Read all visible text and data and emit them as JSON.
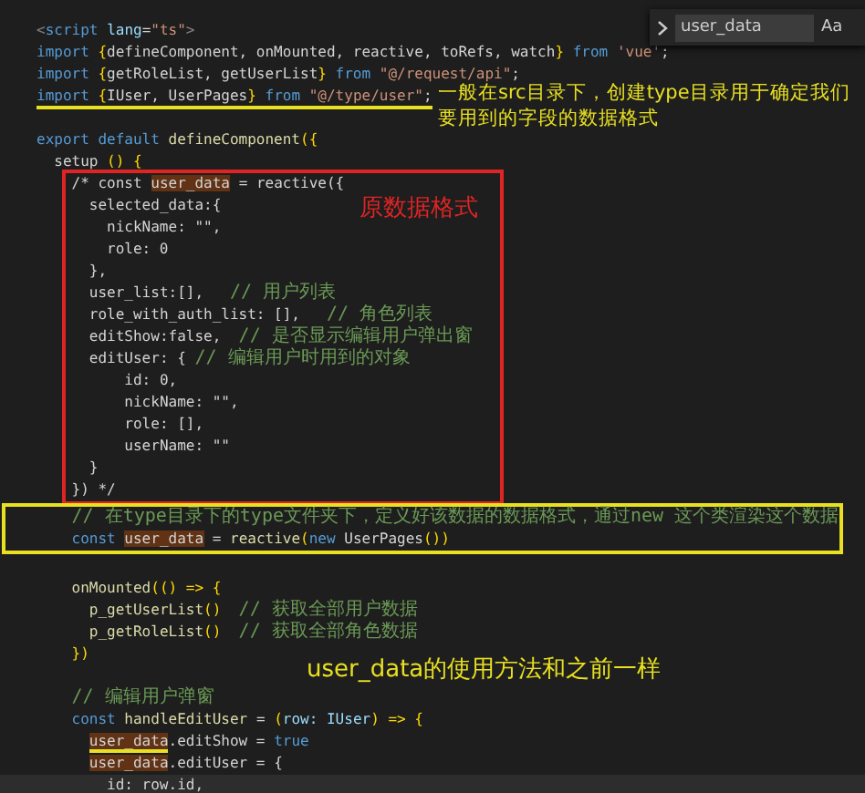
{
  "editor": {
    "blocks": [
      {
        "kind": "plain",
        "lines": [
          {
            "tokens": [
              {
                "t": "<",
                "kind": "tag"
              },
              {
                "t": "script",
                "kind": "kw"
              },
              {
                "t": " lang",
                "kind": "var"
              },
              {
                "t": "=",
                "kind": "p"
              },
              {
                "t": "\"ts\"",
                "kind": "str"
              },
              {
                "t": ">",
                "kind": "tag"
              }
            ]
          },
          {
            "tokens": [
              {
                "t": "import ",
                "kind": "kw"
              },
              {
                "t": "{",
                "kind": "br"
              },
              {
                "t": "defineComponent, onMounted, reactive, toRefs, watch",
                "kind": "p"
              },
              {
                "t": "}",
                "kind": "br"
              },
              {
                "t": " from ",
                "kind": "kw"
              },
              {
                "t": "'vue'",
                "kind": "str"
              },
              {
                "t": ";",
                "kind": "p"
              }
            ]
          },
          {
            "tokens": [
              {
                "t": "import ",
                "kind": "kw"
              },
              {
                "t": "{",
                "kind": "br"
              },
              {
                "t": "getRoleList, getUserList",
                "kind": "p"
              },
              {
                "t": "}",
                "kind": "br"
              },
              {
                "t": " from ",
                "kind": "kw"
              },
              {
                "t": "\"@/request/api\"",
                "kind": "str"
              },
              {
                "t": ";",
                "kind": "p"
              }
            ]
          },
          {
            "underlined": true,
            "note": "一般在src目录下，创建type目录用于确定我们要用到的字段的数据格式",
            "tokens": [
              {
                "t": "import ",
                "kind": "kw"
              },
              {
                "t": "{",
                "kind": "br"
              },
              {
                "t": "IUser, UserPages",
                "kind": "p"
              },
              {
                "t": "}",
                "kind": "br"
              },
              {
                "t": " from ",
                "kind": "kw"
              },
              {
                "t": "\"@/type/user\"",
                "kind": "str"
              },
              {
                "t": ";",
                "kind": "p"
              }
            ]
          },
          {
            "space_above": true,
            "tokens": [
              {
                "t": "export default ",
                "kind": "kw"
              },
              {
                "t": "defineComponent",
                "kind": "fn"
              },
              {
                "t": "({",
                "kind": "br"
              }
            ]
          },
          {
            "tokens": [
              {
                "t": "  setup ",
                "kind": "p"
              },
              {
                "t": "() {",
                "kind": "br"
              }
            ]
          }
        ]
      },
      {
        "kind": "red-frame",
        "note": "原数据格式",
        "lines": [
          {
            "tokens": [
              {
                "t": "    /* const ",
                "kind": "p"
              },
              {
                "t": "user_data",
                "kind": "hl"
              },
              {
                "t": " = reactive({",
                "kind": "p"
              }
            ]
          },
          {
            "tokens": [
              {
                "t": "      selected_data:{",
                "kind": "p"
              }
            ]
          },
          {
            "tokens": [
              {
                "t": "        nickName: \"\",",
                "kind": "p"
              }
            ]
          },
          {
            "tokens": [
              {
                "t": "        role: 0",
                "kind": "p"
              }
            ]
          },
          {
            "tokens": [
              {
                "t": "      },",
                "kind": "p"
              }
            ]
          },
          {
            "tokens": [
              {
                "t": "      user_list:[],   ",
                "kind": "p"
              },
              {
                "t": "// 用户列表",
                "kind": "cm"
              }
            ]
          },
          {
            "tokens": [
              {
                "t": "      role_with_auth_list: [],   ",
                "kind": "p"
              },
              {
                "t": "// 角色列表",
                "kind": "cm"
              }
            ]
          },
          {
            "tokens": [
              {
                "t": "      editShow:false,  ",
                "kind": "p"
              },
              {
                "t": "// 是否显示编辑用户弹出窗",
                "kind": "cm"
              }
            ]
          },
          {
            "tokens": [
              {
                "t": "      editUser: { ",
                "kind": "p"
              },
              {
                "t": "// 编辑用户时用到的对象",
                "kind": "cm"
              }
            ]
          },
          {
            "tokens": [
              {
                "t": "          id: 0,",
                "kind": "p"
              }
            ]
          },
          {
            "tokens": [
              {
                "t": "          nickName: \"\",",
                "kind": "p"
              }
            ]
          },
          {
            "tokens": [
              {
                "t": "          role: [],",
                "kind": "p"
              }
            ]
          },
          {
            "tokens": [
              {
                "t": "          userName: \"\"",
                "kind": "p"
              }
            ]
          },
          {
            "tokens": [
              {
                "t": "      }",
                "kind": "p"
              }
            ]
          },
          {
            "tokens": [
              {
                "t": "    }) */",
                "kind": "p"
              }
            ]
          }
        ]
      },
      {
        "kind": "yellow-frame",
        "lines": [
          {
            "tokens": [
              {
                "t": "    // 在type目录下的type文件夹下，定义好该数据的数据格式，通过new 这个类渲染这个数据",
                "kind": "cm"
              }
            ]
          },
          {
            "tokens": [
              {
                "t": "    const ",
                "kind": "kw"
              },
              {
                "t": "user_data",
                "kind": "hl"
              },
              {
                "t": " = ",
                "kind": "p"
              },
              {
                "t": "reactive",
                "kind": "fn"
              },
              {
                "t": "(",
                "kind": "br"
              },
              {
                "t": "new ",
                "kind": "kw"
              },
              {
                "t": "UserPages",
                "kind": "p"
              },
              {
                "t": "())",
                "kind": "br"
              }
            ]
          }
        ]
      },
      {
        "kind": "plain",
        "lines": [
          {
            "space_above": true,
            "tokens": [
              {
                "t": "    onMounted",
                "kind": "fn"
              },
              {
                "t": "(() => {",
                "kind": "br"
              }
            ]
          },
          {
            "tokens": [
              {
                "t": "      p_getUserList",
                "kind": "fn"
              },
              {
                "t": "()  ",
                "kind": "br"
              },
              {
                "t": "// 获取全部用户数据",
                "kind": "cm"
              }
            ]
          },
          {
            "tokens": [
              {
                "t": "      p_getRoleList",
                "kind": "fn"
              },
              {
                "t": "()  ",
                "kind": "br"
              },
              {
                "t": "// 获取全部角色数据",
                "kind": "cm"
              }
            ]
          },
          {
            "tokens": [
              {
                "t": "    })",
                "kind": "br"
              }
            ]
          },
          {
            "note": "user_data的使用方法和之前一样"
          },
          {
            "tokens": [
              {
                "t": "    // 编辑用户弹窗",
                "kind": "cm"
              }
            ]
          },
          {
            "tokens": [
              {
                "t": "    const ",
                "kind": "kw"
              },
              {
                "t": "handleEditUser",
                "kind": "fn"
              },
              {
                "t": " = ",
                "kind": "p"
              },
              {
                "t": "(",
                "kind": "br"
              },
              {
                "t": "row: IUser",
                "kind": "var"
              },
              {
                "t": ") => {",
                "kind": "br"
              }
            ]
          },
          {
            "tokens": [
              {
                "t": "      user_data",
                "kind": "hlu"
              },
              {
                "t": ".editShow = ",
                "kind": "p"
              },
              {
                "t": "true",
                "kind": "kw"
              }
            ]
          },
          {
            "tokens": [
              {
                "t": "      user_data",
                "kind": "hl"
              },
              {
                "t": ".editUser = {",
                "kind": "p"
              }
            ]
          },
          {
            "current": true,
            "tokens": [
              {
                "t": "        id: row.id,",
                "kind": "p"
              }
            ]
          }
        ]
      }
    ]
  },
  "find_widget": {
    "value": "user_data",
    "toggle": "Aa"
  }
}
